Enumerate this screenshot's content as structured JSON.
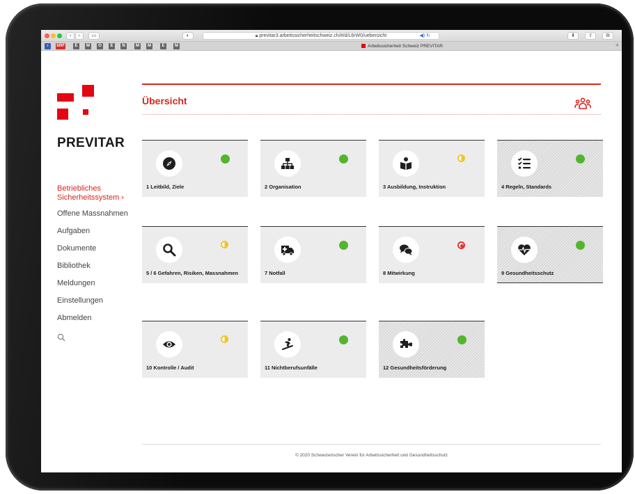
{
  "browser": {
    "url": "previtar3.arbeitssicherheitschweiz.ch/#/d/L6rW0/uebersicht",
    "tab_title": "Arbeitssicherheit Schweiz PREVITAR",
    "favorites": [
      "SRF",
      "E",
      "M",
      "O",
      "E",
      "N",
      "M",
      "M",
      "E",
      "M"
    ]
  },
  "sidebar": {
    "brand": "PREVITAR",
    "items": [
      {
        "label": "Betriebliches Sicherheitssystem  ›",
        "active": true
      },
      {
        "label": "Offene Massnahmen"
      },
      {
        "label": "Aufgaben"
      },
      {
        "label": "Dokumente"
      },
      {
        "label": "Bibliothek"
      },
      {
        "label": "Meldungen"
      },
      {
        "label": "Einstellungen"
      },
      {
        "label": "Abmelden"
      }
    ]
  },
  "header": {
    "title": "Übersicht"
  },
  "tiles": [
    {
      "label": "1 Leitbild, Ziele",
      "icon": "compass-icon",
      "status": "green"
    },
    {
      "label": "2 Organisation",
      "icon": "org-chart-icon",
      "status": "green"
    },
    {
      "label": "3 Ausbildung, Instruktion",
      "icon": "reader-icon",
      "status": "half"
    },
    {
      "label": "4 Regeln, Standards",
      "icon": "checklist-icon",
      "status": "green"
    },
    {
      "label": "5 / 6 Gefahren, Risiken, Massnahmen",
      "icon": "magnifier-icon",
      "status": "half"
    },
    {
      "label": "7 Notfall",
      "icon": "ambulance-icon",
      "status": "green"
    },
    {
      "label": "8 Mitwirkung",
      "icon": "chat-icon",
      "status": "target"
    },
    {
      "label": "9 Gesundheitsschutz",
      "icon": "heartbeat-icon",
      "status": "green"
    },
    {
      "label": "10 Kontrolle / Audit",
      "icon": "eye-icon",
      "status": "half"
    },
    {
      "label": "11 Nichtberufsunfälle",
      "icon": "snowboarder-icon",
      "status": "green"
    },
    {
      "label": "12 Gesundheitsförderung",
      "icon": "puzzle-icon",
      "status": "green"
    }
  ],
  "colors": {
    "accent": "#d9261c",
    "green": "#53b52e",
    "yellow": "#f0c52a",
    "red": "#e4332e"
  },
  "footer": {
    "text": "© 2020 Schweizerischer Verein für Arbeitssicherheit und Gesundheitsschutz"
  }
}
